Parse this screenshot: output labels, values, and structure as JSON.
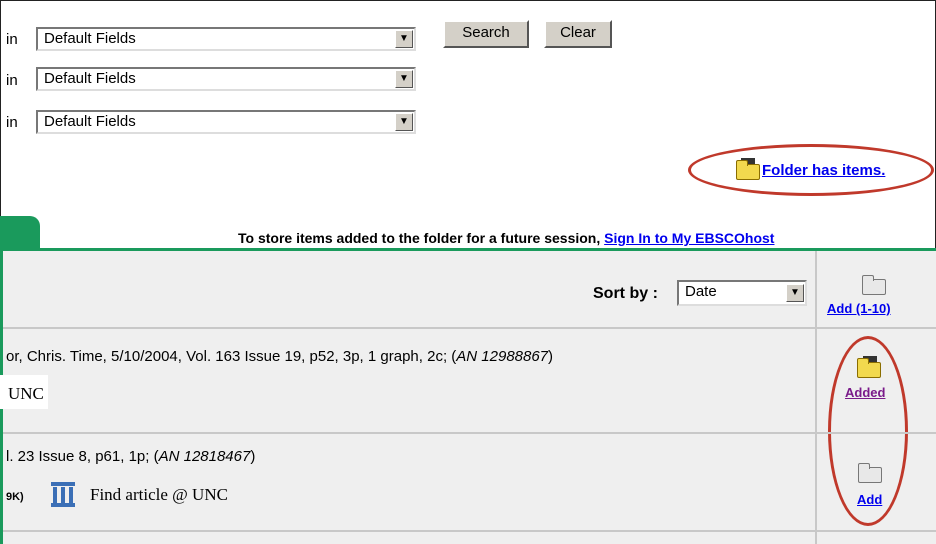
{
  "search": {
    "rows": [
      {
        "in_label": "in",
        "field": "Default Fields"
      },
      {
        "in_label": "in",
        "field": "Default Fields"
      },
      {
        "in_label": "in",
        "field": "Default Fields"
      }
    ],
    "search_button": "Search",
    "clear_button": "Clear"
  },
  "folder": {
    "status_link": "Folder has items.",
    "icon": "folder-with-items-icon"
  },
  "notice": {
    "text": "To store items added to the folder for a future session,",
    "signin_link": "Sign In to My EBSCOhost"
  },
  "results": {
    "sort_label": "Sort by :",
    "sort_value": "Date",
    "add_range_link": "Add (1-10)",
    "items": [
      {
        "citation": "or, Chris. Time, 5/10/2004, Vol. 163 Issue 19, p52, 3p, 1 graph, 2c; (",
        "an": "AN 12988867",
        "citation_end": ")",
        "holding": "UNC",
        "folder_link": "Added"
      },
      {
        "citation": "l. 23 Issue 8, p61, 1p; (",
        "an": "AN 12818467",
        "citation_end": ")",
        "size": "9K)",
        "holding": "Find article @ UNC",
        "folder_link": "Add"
      }
    ]
  },
  "colors": {
    "accent_green": "#1a9a5c",
    "annotation_red": "#c0392b",
    "link_blue": "#0000ee",
    "visited_purple": "#7a1a8a"
  }
}
